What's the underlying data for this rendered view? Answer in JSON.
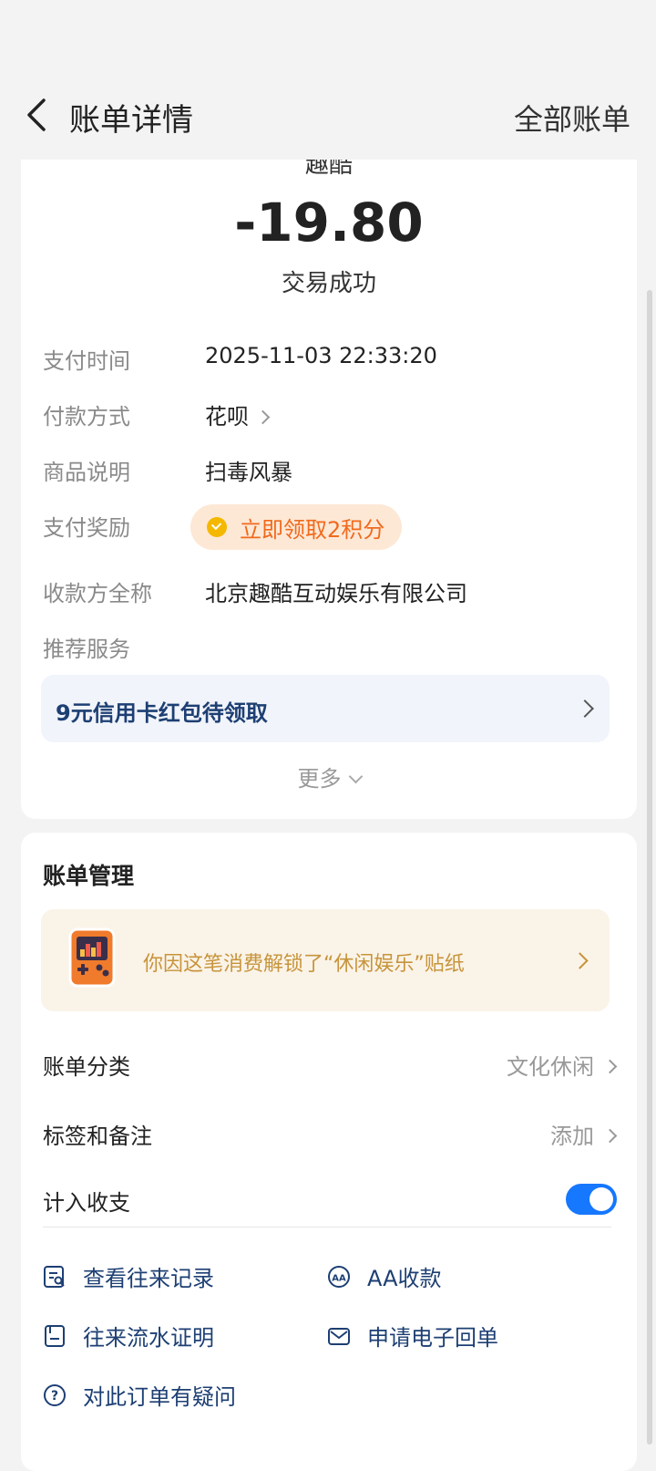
{
  "header": {
    "title": "账单详情",
    "right_link": "全部账单"
  },
  "transaction": {
    "merchant": "趣酷",
    "amount": "-19.80",
    "status": "交易成功"
  },
  "details": [
    {
      "label": "支付时间",
      "value": "2025-11-03 22:33:20"
    },
    {
      "label": "付款方式",
      "value": "花呗"
    },
    {
      "label": "商品说明",
      "value": "扫毒风暴"
    },
    {
      "label": "支付奖励",
      "value": "立即领取2积分"
    },
    {
      "label": "收款方全称",
      "value": "北京趣酷互动娱乐有限公司"
    },
    {
      "label": "推荐服务",
      "value": ""
    }
  ],
  "promo": {
    "text": "9元信用卡红包待领取"
  },
  "more": "更多",
  "manage": {
    "title": "账单管理",
    "sticker_text": "你因这笔消费解锁了“休闲娱乐”贴纸",
    "category_label": "账单分类",
    "category_value": "文化休闲",
    "tags_label": "标签和备注",
    "tags_value": "添加",
    "include_label": "计入收支",
    "include_on": true
  },
  "actions": [
    {
      "label": "查看往来记录",
      "icon": "record-icon"
    },
    {
      "label": "AA收款",
      "icon": "aa-icon"
    },
    {
      "label": "往来流水证明",
      "icon": "document-icon"
    },
    {
      "label": "申请电子回单",
      "icon": "mail-icon"
    },
    {
      "label": "对此订单有疑问",
      "icon": "question-icon"
    }
  ],
  "colors": {
    "accent": "#1677ff",
    "promo_text": "#1d3f73",
    "reward_text": "#f06a1d",
    "sticker_text": "#c7943a"
  }
}
